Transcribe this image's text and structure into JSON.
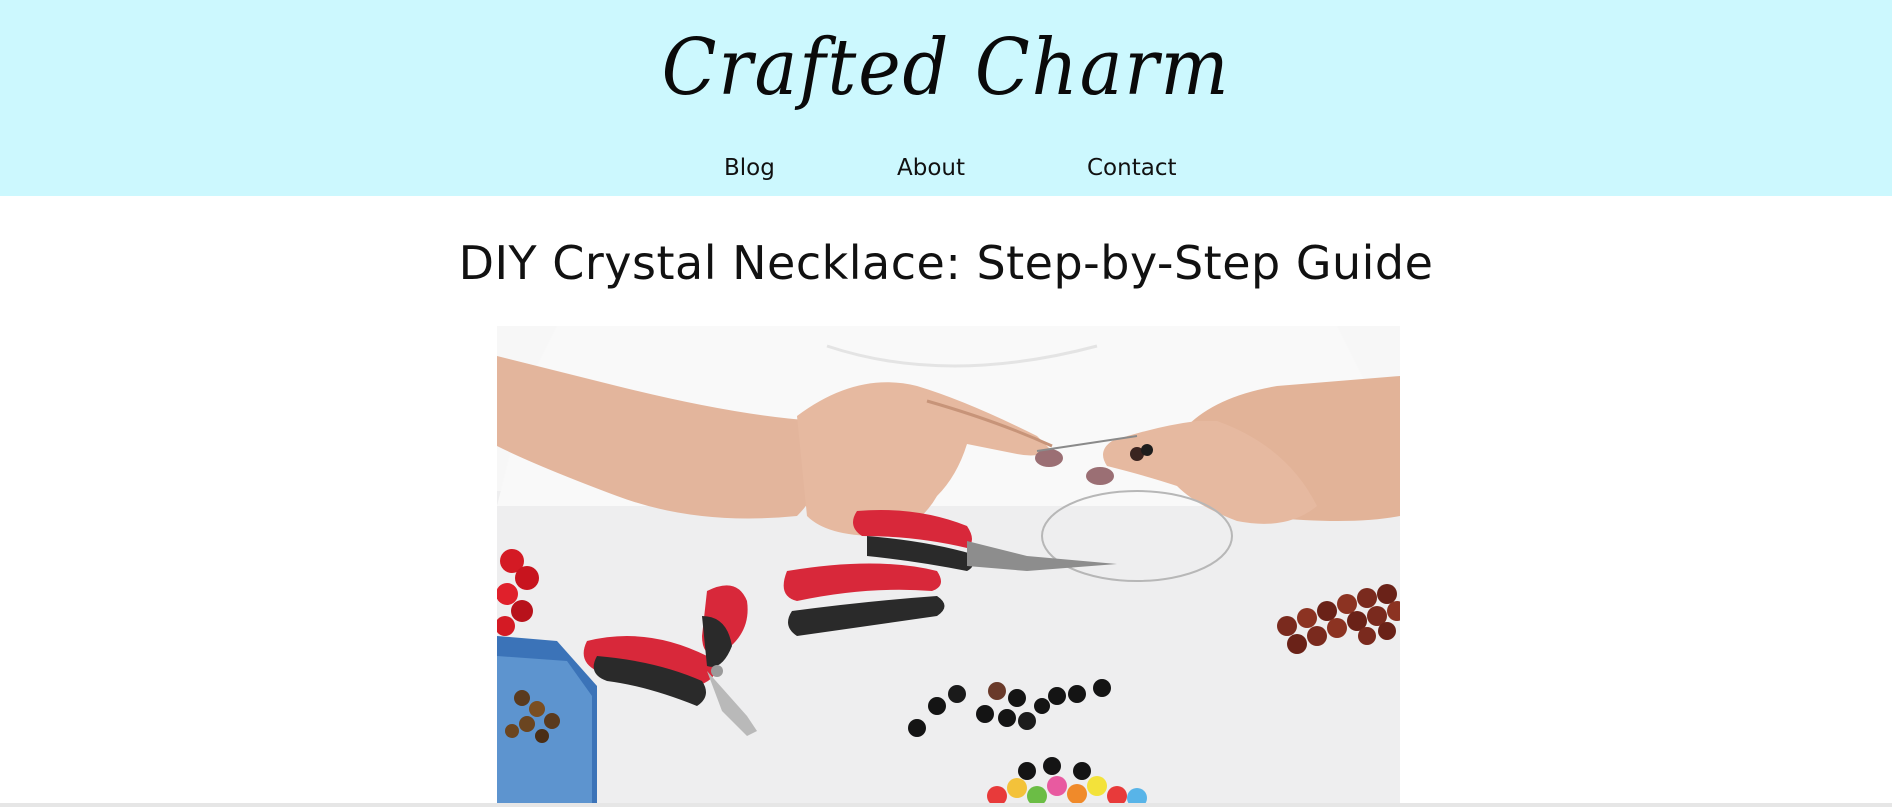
{
  "site": {
    "logo_text": "Crafted Charm"
  },
  "nav": {
    "items": [
      {
        "label": "Blog"
      },
      {
        "label": "About"
      },
      {
        "label": "Contact"
      }
    ]
  },
  "post": {
    "title": "DIY Crystal Necklace: Step-by-Step Guide"
  },
  "colors": {
    "header_background": "#ccf8fe",
    "page_background": "#ffffff",
    "text": "#111111"
  }
}
